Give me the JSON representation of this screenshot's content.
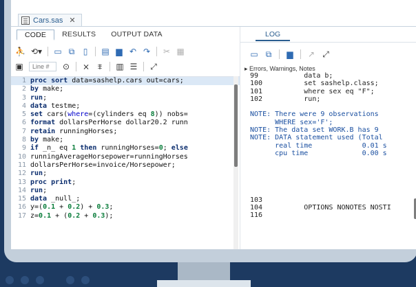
{
  "file_tab": {
    "name": "Cars.sas",
    "close": "✕"
  },
  "editor": {
    "tabs": [
      "CODE",
      "RESULTS",
      "OUTPUT DATA"
    ],
    "line_number_placeholder": "Line #",
    "lines": [
      {
        "n": "1",
        "t": "<b>proc sort</b> data=sashelp.cars out=cars;"
      },
      {
        "n": "2",
        "t": "<b>by</b> make;"
      },
      {
        "n": "3",
        "t": "<b>run</b>;"
      },
      {
        "n": "4",
        "t": "<b>data</b> testme;"
      },
      {
        "n": "5",
        "t": "<b>set</b> cars(<i>where</i>=(cylinders eq <span class='n'>8</span>)) nobs="
      },
      {
        "n": "6",
        "t": "<b>format</b> dollarsPerHorse dollar20.2 runn"
      },
      {
        "n": "7",
        "t": "<b>retain</b> runningHorses;"
      },
      {
        "n": "8",
        "t": "<b>by</b> make;"
      },
      {
        "n": "9",
        "t": "<b>if</b> _n_ eq <span class='n'>1</span> <b>then</b> runningHorses=<span class='n'>0</span>; <b>else</b>"
      },
      {
        "n": "10",
        "t": "runningAverageHorsepower=runningHorses"
      },
      {
        "n": "11",
        "t": "dollarsPerHorse=invoice/Horsepower;"
      },
      {
        "n": "12",
        "t": "<b>run</b>;"
      },
      {
        "n": "13",
        "t": "<b>proc print</b>;"
      },
      {
        "n": "14",
        "t": "<b>run</b>;"
      },
      {
        "n": "15",
        "t": "<b>data</b> _null_;"
      },
      {
        "n": "16",
        "t": "y=(<span class='n'>0.1</span> + <span class='n'>0.2</span>) + <span class='n'>0.3</span>;"
      },
      {
        "n": "17",
        "t": "z=<span class='n'>0.1</span> + (<span class='n'>0.2</span> + <span class='n'>0.3</span>);"
      }
    ]
  },
  "log": {
    "tab": "LOG",
    "errors_label": "Errors, Warnings, Notes",
    "lines": [
      {
        "t": " 99           data b;",
        "c": ""
      },
      {
        "t": " 100          set sashelp.class;",
        "c": ""
      },
      {
        "t": " 101          where sex eq \"F\";",
        "c": ""
      },
      {
        "t": " 102          run;",
        "c": ""
      },
      {
        "t": "",
        "c": ""
      },
      {
        "t": " NOTE: There were 9 observations",
        "c": "note"
      },
      {
        "t": "       WHERE sex='F';",
        "c": "note"
      },
      {
        "t": " NOTE: The data set WORK.B has 9",
        "c": "note"
      },
      {
        "t": " NOTE: DATA statement used (Total",
        "c": "note"
      },
      {
        "t": "       real time            0.01 s",
        "c": "note"
      },
      {
        "t": "       cpu time             0.00 s",
        "c": "note"
      },
      {
        "t": "",
        "c": ""
      },
      {
        "t": "",
        "c": ""
      },
      {
        "t": "",
        "c": ""
      },
      {
        "t": "",
        "c": ""
      },
      {
        "t": "",
        "c": ""
      },
      {
        "t": " 103",
        "c": ""
      },
      {
        "t": " 104          OPTIONS NONOTES NOSTI",
        "c": ""
      },
      {
        "t": " 116",
        "c": ""
      }
    ]
  },
  "icons": [
    "run-icon",
    "recall-icon",
    "save-icon",
    "new-icon",
    "open-icon",
    "print-icon",
    "undo-icon",
    "redo-icon",
    "cut-icon",
    "paste-icon",
    "maximize-icon"
  ],
  "colors": {
    "background": "#1d3a61",
    "bezel": "#c3cfdb",
    "accent": "#2a5d8f"
  }
}
